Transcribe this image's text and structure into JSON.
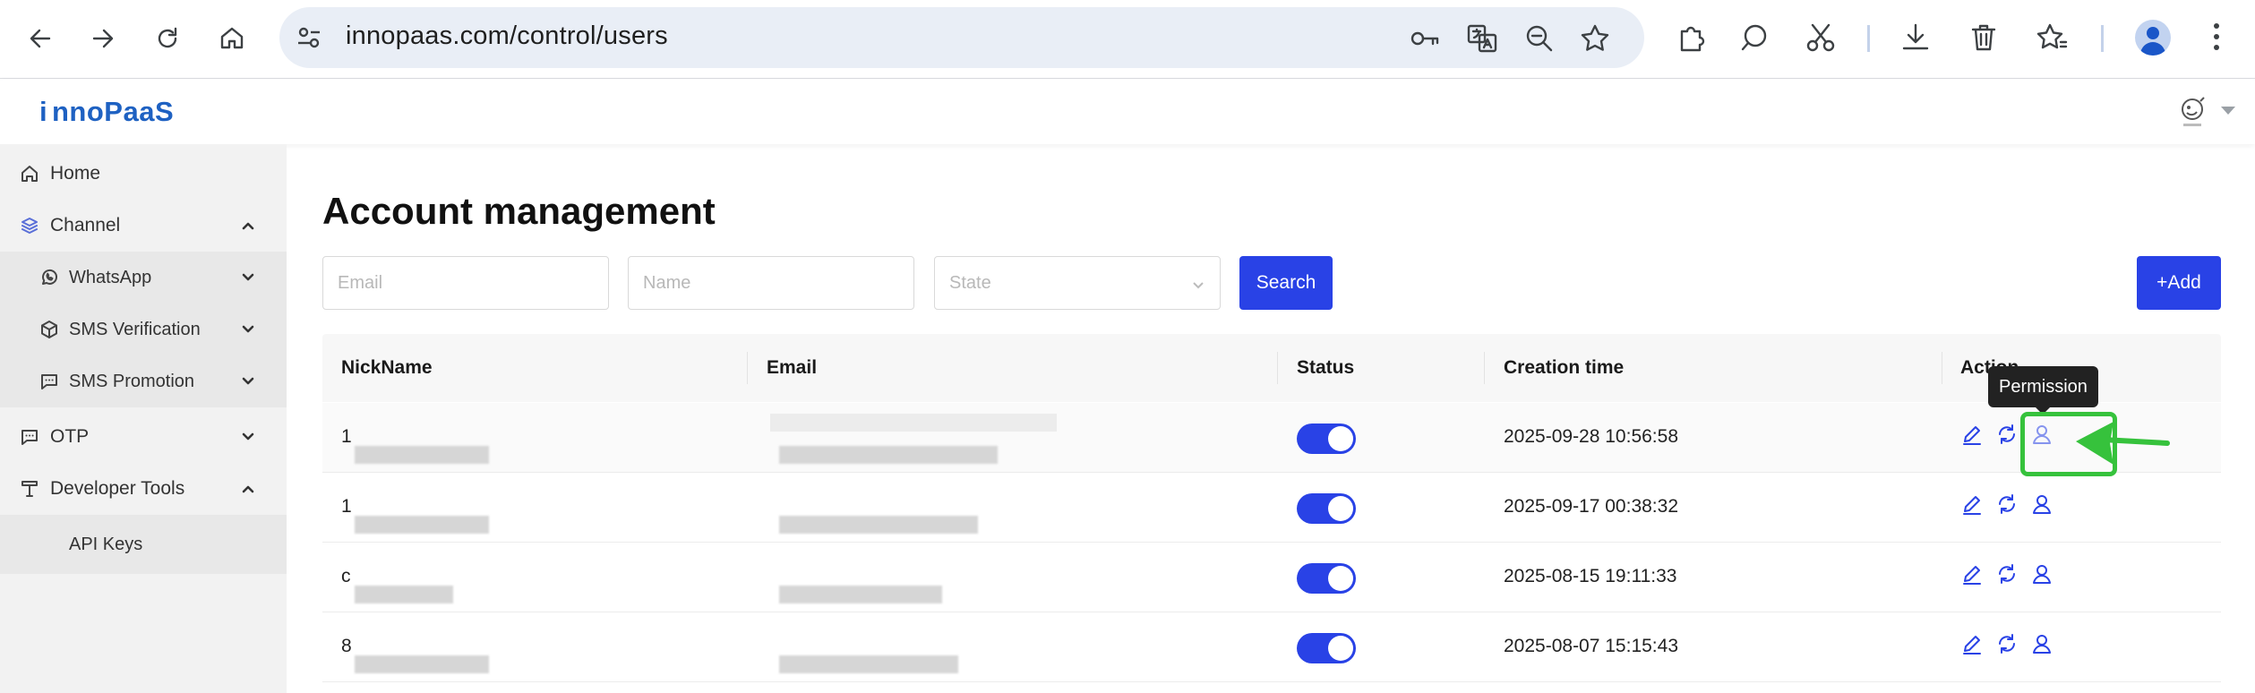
{
  "browser": {
    "url": "innopaas.com/control/users",
    "profile_color": "#1a56c8"
  },
  "app": {
    "logo_text": "nnoPaaS",
    "logo_prefix": "i",
    "brand_color": "#1e61c2",
    "accent_color": "#2942e6"
  },
  "sidebar": {
    "items": [
      {
        "label": "Home",
        "icon": "home-icon"
      },
      {
        "label": "Channel",
        "icon": "layers-icon",
        "expanded": true
      },
      {
        "label": "WhatsApp",
        "icon": "whatsapp-icon"
      },
      {
        "label": "SMS Verification",
        "icon": "cube-icon"
      },
      {
        "label": "SMS Promotion",
        "icon": "chat-dots-icon"
      },
      {
        "label": "OTP",
        "icon": "chat-dots-icon"
      },
      {
        "label": "Developer Tools",
        "icon": "tool-icon",
        "expanded": true
      },
      {
        "label": "API Keys",
        "icon": ""
      }
    ]
  },
  "main": {
    "title": "Account management",
    "filters": {
      "email_placeholder": "Email",
      "name_placeholder": "Name",
      "state_placeholder": "State"
    },
    "search_label": "Search",
    "add_label": "+Add"
  },
  "table": {
    "columns": [
      "NickName",
      "Email",
      "Status",
      "Creation time",
      "Action"
    ],
    "rows": [
      {
        "nickname": "1",
        "email": "",
        "status": "on",
        "created": "2025-09-28 10:56:58"
      },
      {
        "nickname": "1",
        "email": "",
        "status": "on",
        "created": "2025-09-17 00:38:32"
      },
      {
        "nickname": "c",
        "email": "",
        "status": "on",
        "created": "2025-08-15 19:11:33"
      },
      {
        "nickname": "8",
        "email": "",
        "status": "on",
        "created": "2025-08-07 15:15:43"
      }
    ]
  },
  "tooltip": {
    "text": "Permission"
  },
  "annotation": {
    "highlight_color": "#36c23c"
  }
}
